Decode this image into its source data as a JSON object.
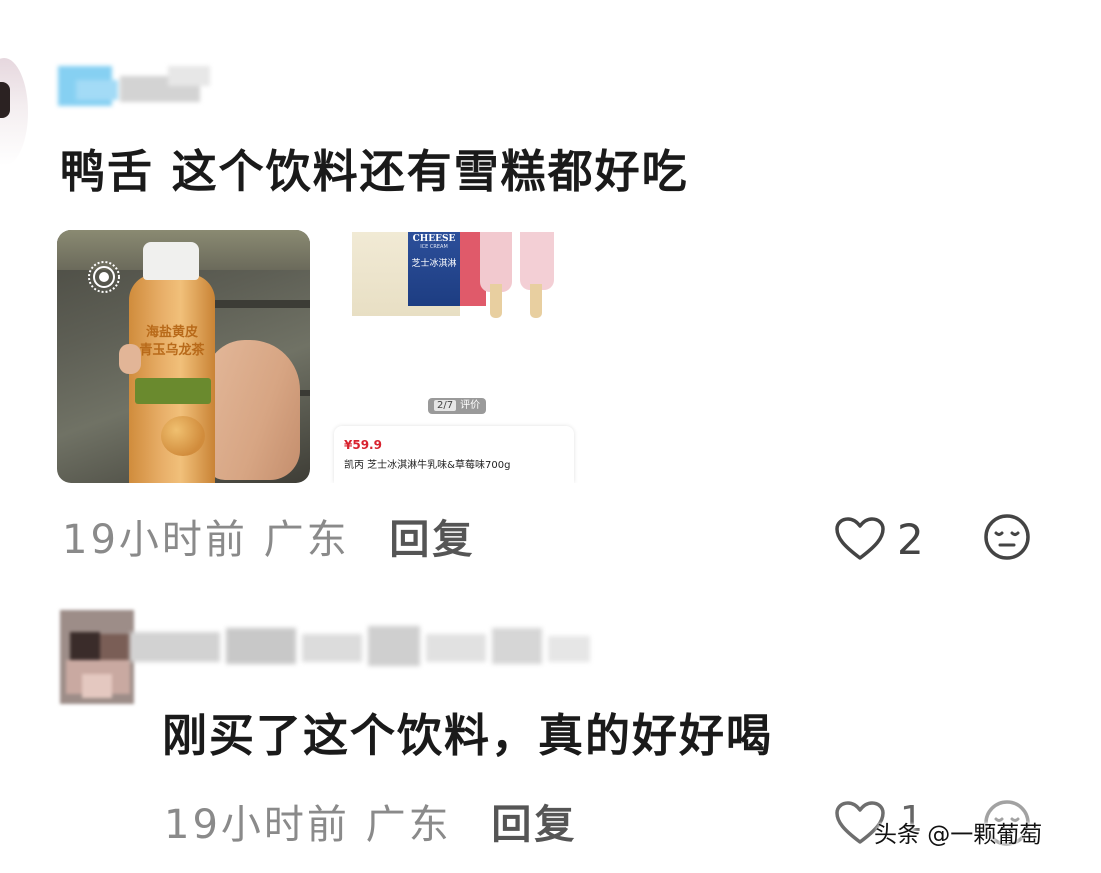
{
  "comments": [
    {
      "text": "鸭舌 这个饮料还有雪糕都好吃",
      "time_location": "19小时前 广东",
      "reply_label": "回复",
      "like_count": "2",
      "images": {
        "photo1": {
          "label_line1": "海盐黄皮",
          "label_line2": "青玉乌龙茶"
        },
        "photo2": {
          "brand_en": "CHEESE",
          "brand_sub": "ICE CREAM",
          "brand_cn": "芝士冰淇淋",
          "pager_index": "2/7",
          "pager_label": "评价",
          "price": "¥59.9",
          "product_title": "凯丙 芝士冰淇淋牛乳味&草莓味700g"
        }
      }
    },
    {
      "text": "刚买了这个饮料，真的好好喝",
      "time_location": "19小时前 广东",
      "reply_label": "回复",
      "like_count": "1"
    }
  ],
  "watermark": "头条 @一颗葡萄",
  "icons": {
    "like": "heart-outline-icon",
    "emoji": "expressionless-face-icon",
    "live_photo": "live-photo-icon"
  },
  "colors": {
    "meta_gray": "#8a8a8a",
    "price_red": "#d8232f"
  }
}
